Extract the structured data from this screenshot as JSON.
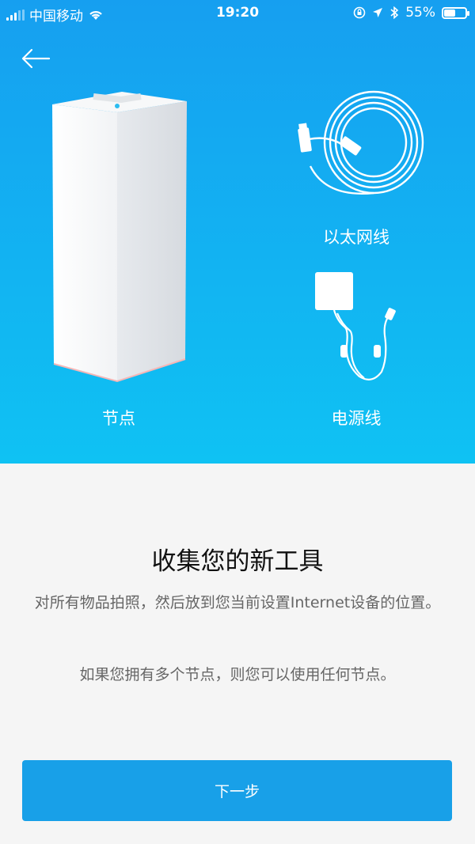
{
  "status_bar": {
    "carrier": "中国移动",
    "time": "19:20",
    "battery_percent": "55%",
    "battery_level": 0.55,
    "icons": [
      "signal-icon",
      "wifi-icon",
      "lock-rotation-icon",
      "location-icon",
      "bluetooth-icon",
      "battery-icon"
    ]
  },
  "hero": {
    "back_icon": "arrow-left-icon",
    "items": {
      "node_label": "节点",
      "ethernet_label": "以太网线",
      "power_label": "电源线"
    }
  },
  "main": {
    "title": "收集您的新工具",
    "paragraph1": "对所有物品拍照，然后放到您当前设置Internet设备的位置。",
    "paragraph2": "如果您拥有多个节点，则您可以使用任何节点。",
    "next_button": "下一步"
  },
  "colors": {
    "hero_top": "#169ff0",
    "hero_bottom": "#0fc2f3",
    "button": "#18a0e8"
  }
}
